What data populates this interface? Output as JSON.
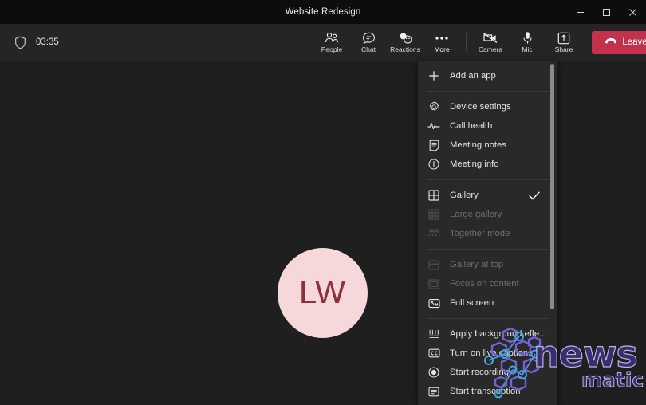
{
  "window": {
    "title": "Website Redesign",
    "controls": [
      {
        "name": "minimize",
        "label": "–"
      },
      {
        "name": "maximize",
        "label": "□"
      },
      {
        "name": "close",
        "label": "×"
      }
    ]
  },
  "toolbar": {
    "shield_icon": "shield-icon",
    "timer": "03:35",
    "center_items": [
      {
        "label": "People",
        "icon": "people-icon"
      },
      {
        "label": "Chat",
        "icon": "chat-icon"
      },
      {
        "label": "Reactions",
        "icon": "reactions-icon"
      },
      {
        "label": "More",
        "icon": "more-ellipsis-icon"
      }
    ],
    "right_items": [
      {
        "label": "Camera",
        "icon": "camera-off-icon",
        "muted": true
      },
      {
        "label": "Mic",
        "icon": "microphone-icon",
        "muted": false
      },
      {
        "label": "Share",
        "icon": "share-screen-icon",
        "muted": false
      }
    ],
    "leave_label": "Leave",
    "leave_color": "#c4314b"
  },
  "stage": {
    "avatar_initials": "LW",
    "avatar_bg": "#f6d7da",
    "avatar_fg": "#8e2f3c"
  },
  "menu": {
    "items": [
      {
        "label": "Add an app",
        "icon": "plus-icon",
        "disabled": false,
        "checked": false
      },
      {
        "separator": true
      },
      {
        "label": "Device settings",
        "icon": "gear-icon",
        "disabled": false,
        "checked": false
      },
      {
        "label": "Call health",
        "icon": "pulse-icon",
        "disabled": false,
        "checked": false
      },
      {
        "label": "Meeting notes",
        "icon": "notes-icon",
        "disabled": false,
        "checked": false
      },
      {
        "label": "Meeting info",
        "icon": "info-circle-icon",
        "disabled": false,
        "checked": false
      },
      {
        "separator": true
      },
      {
        "label": "Gallery",
        "icon": "grid-2x2-icon",
        "disabled": false,
        "checked": true
      },
      {
        "label": "Large gallery",
        "icon": "grid-3x3-icon",
        "disabled": true,
        "checked": false
      },
      {
        "label": "Together mode",
        "icon": "together-mode-icon",
        "disabled": true,
        "checked": false
      },
      {
        "separator": true
      },
      {
        "label": "Gallery at top",
        "icon": "gallery-top-icon",
        "disabled": true,
        "checked": false
      },
      {
        "label": "Focus on content",
        "icon": "focus-content-icon",
        "disabled": true,
        "checked": false
      },
      {
        "label": "Full screen",
        "icon": "full-screen-icon",
        "disabled": false,
        "checked": false
      },
      {
        "separator": true
      },
      {
        "label": "Apply background effe...",
        "icon": "background-effects-icon",
        "disabled": false,
        "checked": false
      },
      {
        "label": "Turn on live captions",
        "icon": "closed-captions-icon",
        "disabled": false,
        "checked": false
      },
      {
        "label": "Start recording",
        "icon": "record-icon",
        "disabled": false,
        "checked": false
      },
      {
        "label": "Start transcription",
        "icon": "transcription-icon",
        "disabled": false,
        "checked": false
      }
    ]
  },
  "watermark": {
    "primary": "news",
    "secondary": "matic",
    "color": "#3a2f6e",
    "outline": "#b9b4e6"
  }
}
